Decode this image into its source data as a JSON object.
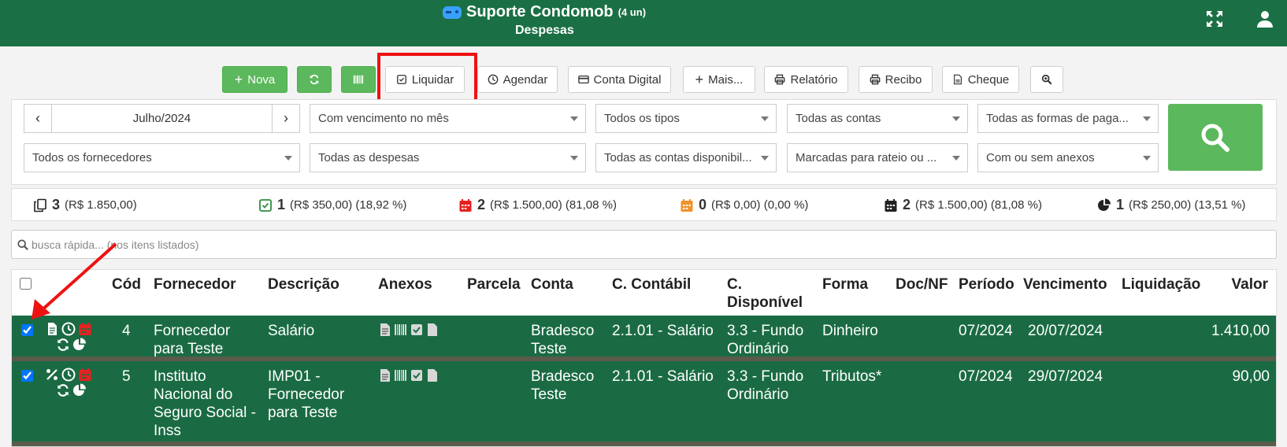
{
  "header": {
    "title": "Suporte Condomob",
    "units": "(4 un)",
    "subtitle": "Despesas"
  },
  "toolbar": {
    "nova": "Nova",
    "liquidar": "Liquidar",
    "agendar": "Agendar",
    "conta_digital": "Conta Digital",
    "mais": "Mais...",
    "relatorio": "Relatório",
    "recibo": "Recibo",
    "cheque": "Cheque"
  },
  "filters": {
    "month": "Julho/2024",
    "vencimento": "Com vencimento no mês",
    "tipos": "Todos os tipos",
    "contas": "Todas as contas",
    "formas": "Todas as formas de paga...",
    "fornecedores": "Todos os fornecedores",
    "despesas": "Todas as despesas",
    "disponiveis": "Todas as contas disponibil...",
    "rateio": "Marcadas para rateio ou ...",
    "anexos": "Com ou sem anexos"
  },
  "summary": [
    {
      "count": "3",
      "text": "(R$ 1.850,00)"
    },
    {
      "count": "1",
      "text": "(R$ 350,00) (18,92 %)"
    },
    {
      "count": "2",
      "text": "(R$ 1.500,00) (81,08 %)"
    },
    {
      "count": "0",
      "text": "(R$ 0,00) (0,00 %)"
    },
    {
      "count": "2",
      "text": "(R$ 1.500,00) (81,08 %)"
    },
    {
      "count": "1",
      "text": "(R$ 250,00) (13,51 %)"
    }
  ],
  "quick_search": {
    "placeholder": "busca rápida... (nos itens listados)"
  },
  "table": {
    "headers": {
      "cod": "Cód",
      "fornecedor": "Fornecedor",
      "descricao": "Descrição",
      "anexos": "Anexos",
      "parcela": "Parcela",
      "conta": "Conta",
      "contabil": "C. Contábil",
      "disponivel_1": "C.",
      "disponivel_2": "Disponível",
      "forma": "Forma",
      "docnf": "Doc/NF",
      "periodo": "Período",
      "vencimento": "Vencimento",
      "liquidacao": "Liquidação",
      "valor": "Valor"
    },
    "rows": [
      {
        "cod": "4",
        "fornecedor_lines": [
          "Fornecedor",
          "para Teste"
        ],
        "descricao_lines": [
          "Salário"
        ],
        "conta_lines": [
          "Bradesco",
          "Teste"
        ],
        "contabil": "2.1.01 - Salário",
        "disponivel_lines": [
          "3.3 - Fundo",
          "Ordinário"
        ],
        "forma": "Dinheiro",
        "periodo": "07/2024",
        "vencimento": "20/07/2024",
        "valor": "1.410,00"
      },
      {
        "cod": "5",
        "fornecedor_lines": [
          "Instituto",
          "Nacional do",
          "Seguro Social -",
          "Inss"
        ],
        "descricao_lines": [
          "IMP01 -",
          "Fornecedor",
          "para Teste"
        ],
        "conta_lines": [
          "Bradesco",
          "Teste"
        ],
        "contabil": "2.1.01 - Salário",
        "disponivel_lines": [
          "3.3 - Fundo",
          "Ordinário"
        ],
        "forma": "Tributos*",
        "periodo": "07/2024",
        "vencimento": "29/07/2024",
        "valor": "90,00"
      }
    ]
  },
  "colors": {
    "header_green": "#1a7044",
    "row_green": "#1a6b43",
    "button_green": "#5cb85c",
    "highlight_red": "#ee1111"
  }
}
